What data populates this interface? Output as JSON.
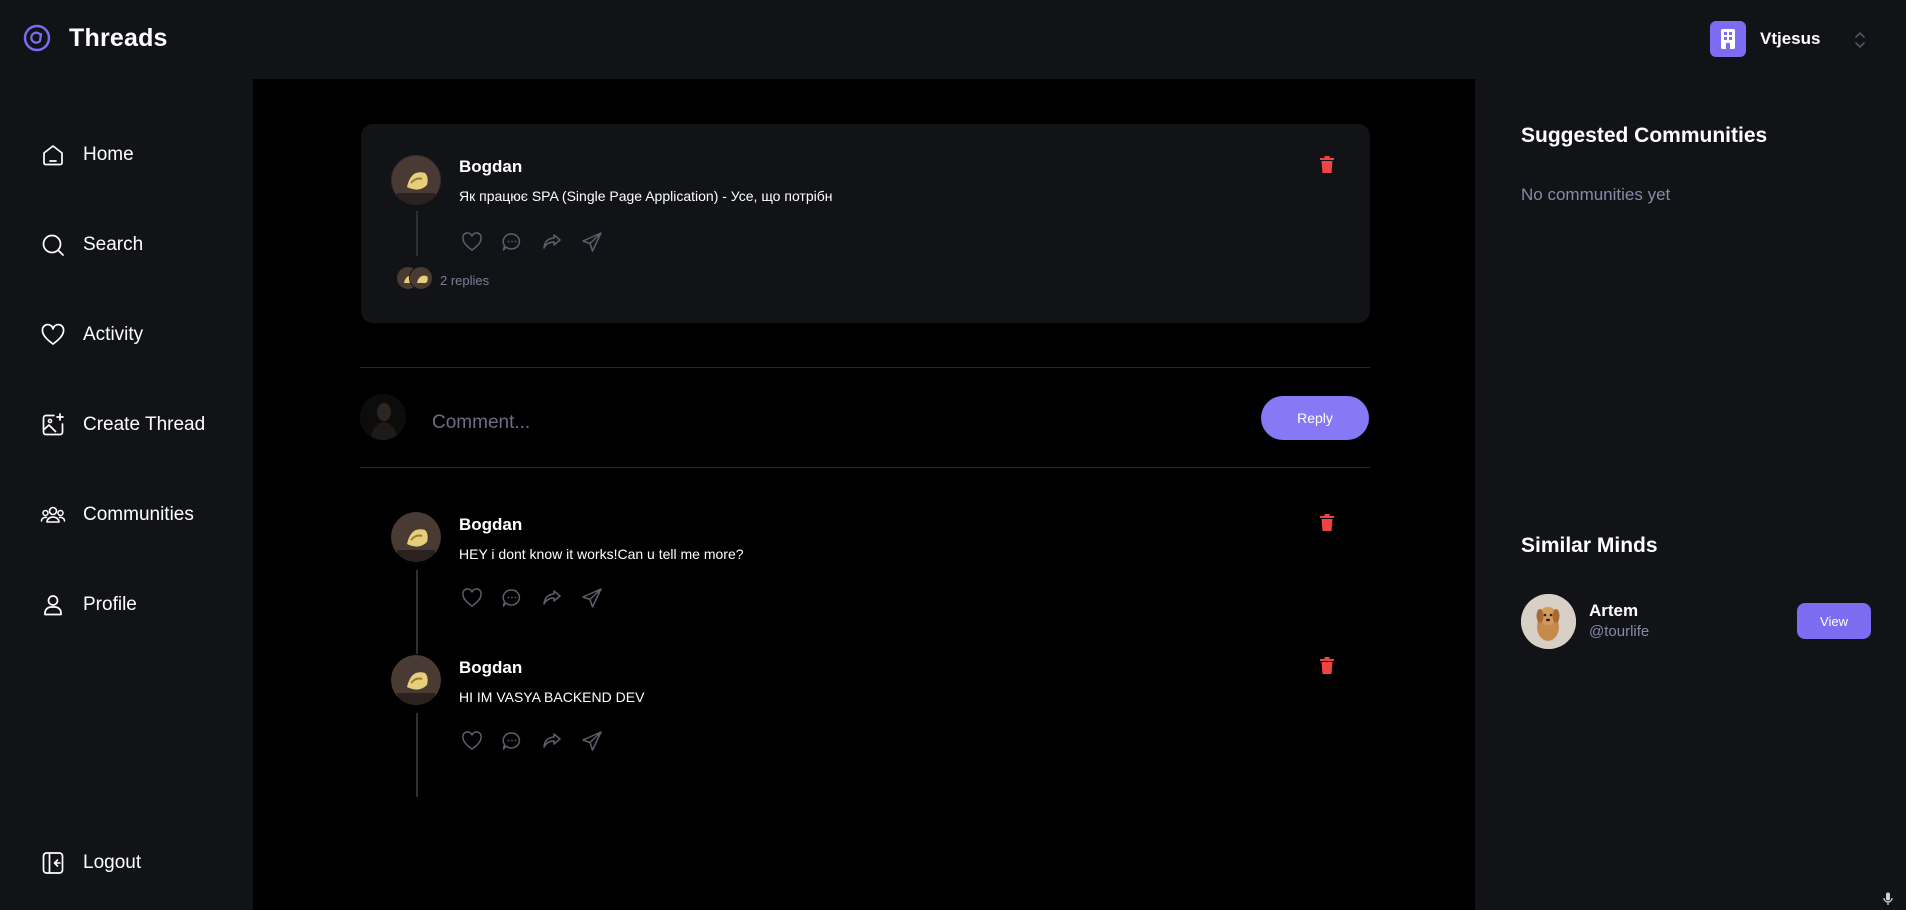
{
  "app": {
    "title": "Threads"
  },
  "org": {
    "name": "Vtjesus"
  },
  "sidebar": {
    "items": [
      {
        "label": "Home",
        "icon": "home-icon"
      },
      {
        "label": "Search",
        "icon": "search-icon"
      },
      {
        "label": "Activity",
        "icon": "heart-icon"
      },
      {
        "label": "Create Thread",
        "icon": "image-plus-icon"
      },
      {
        "label": "Communities",
        "icon": "users-icon"
      },
      {
        "label": "Profile",
        "icon": "user-icon"
      }
    ],
    "logout_label": "Logout"
  },
  "main_thread": {
    "author": "Bogdan",
    "text": "Як працює SPA (Single Page Application) - Усе, що потрібн",
    "replies_label": "2 replies"
  },
  "comment_form": {
    "placeholder": "Comment...",
    "submit_label": "Reply"
  },
  "replies": [
    {
      "author": "Bogdan",
      "text": "HEY i dont know it works!Can u tell me more?"
    },
    {
      "author": "Bogdan",
      "text": "HI IM VASYA BACKEND DEV"
    }
  ],
  "right_sidebar": {
    "suggested_title": "Suggested Communities",
    "suggested_empty": "No communities yet",
    "similar_title": "Similar Minds",
    "users": [
      {
        "name": "Artem",
        "handle": "@tourlife",
        "button_label": "View"
      }
    ]
  },
  "colors": {
    "accent": "#7c6cf2",
    "danger": "#f04444",
    "panel": "#121317",
    "background": "#000000",
    "muted": "#8b89a8"
  }
}
